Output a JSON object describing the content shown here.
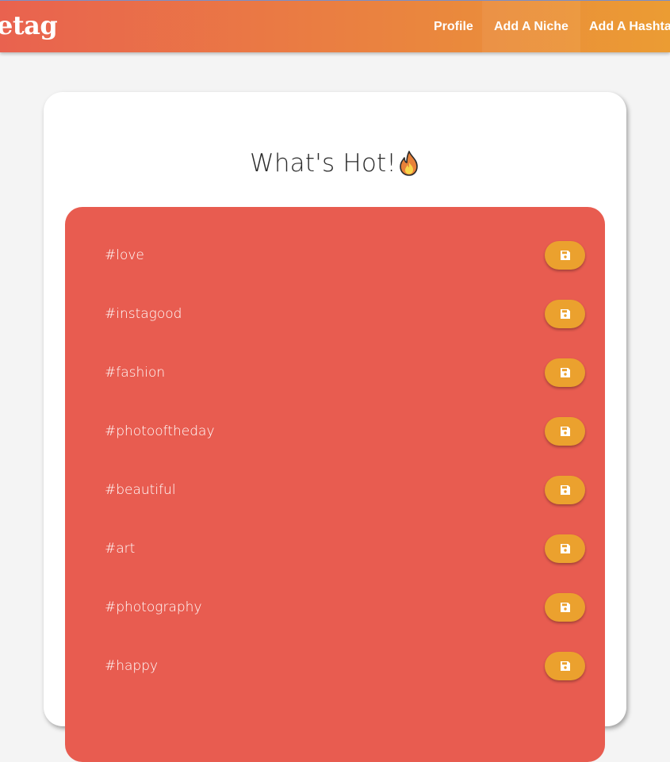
{
  "navbar": {
    "brand": "etag",
    "items": [
      {
        "label": "Profile"
      },
      {
        "label": "Add A Niche"
      },
      {
        "label": "Add A Hashtag"
      }
    ]
  },
  "main": {
    "title": "What's Hot!",
    "title_icon": "fire-icon",
    "hashtags": [
      {
        "tag": "#love"
      },
      {
        "tag": "#instagood"
      },
      {
        "tag": "#fashion"
      },
      {
        "tag": "#photooftheday"
      },
      {
        "tag": "#beautiful"
      },
      {
        "tag": "#art"
      },
      {
        "tag": "#photography"
      },
      {
        "tag": "#happy"
      }
    ],
    "save_icon": "floppy-disk-icon"
  },
  "colors": {
    "nav_gradient_start": "#e9624f",
    "nav_gradient_end": "#eb9c33",
    "panel": "#e85c50",
    "save_button": "#eba12e",
    "background": "#f4f4f4"
  }
}
